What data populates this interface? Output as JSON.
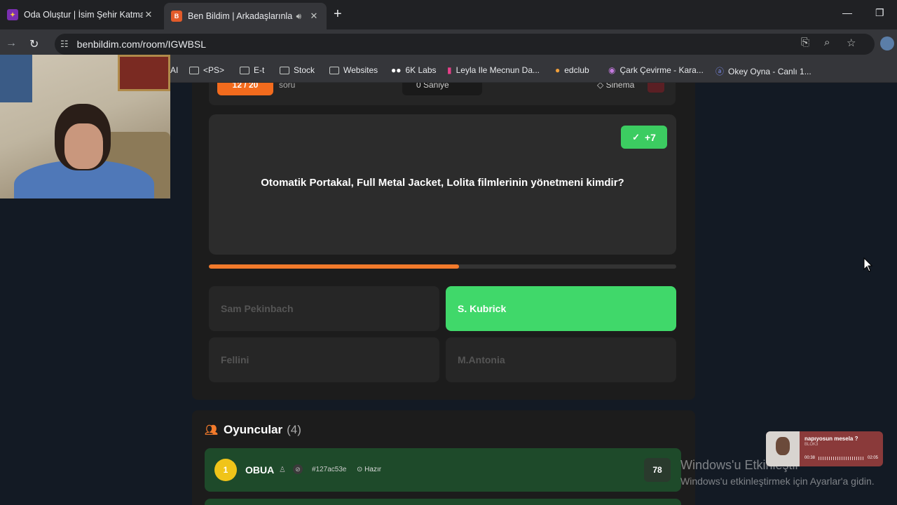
{
  "browser": {
    "tabs": [
      {
        "title": "Oda Oluştur | İsim Şehir Katman",
        "active": false
      },
      {
        "title": "Ben Bildim | Arkadaşlarınla",
        "active": true
      }
    ],
    "url": "benbildim.com/room/IGWBSL",
    "bookmarks": [
      {
        "label": "AI",
        "icon": "truncated"
      },
      {
        "label": "<PS>",
        "icon": "folder-icon"
      },
      {
        "label": "E-t",
        "icon": "folder-icon"
      },
      {
        "label": "Stock",
        "icon": "folder-icon"
      },
      {
        "label": "Websites",
        "icon": "folder-icon"
      },
      {
        "label": "6K Labs",
        "icon": "labs-icon"
      },
      {
        "label": "Leyla Ile Mecnun Da...",
        "icon": "bookmark-icon"
      },
      {
        "label": "edclub",
        "icon": "edclub-icon"
      },
      {
        "label": "Çark Çevirme - Kara...",
        "icon": "wheel-icon"
      },
      {
        "label": "Okey Oyna - Canlı 1...",
        "icon": "okey-icon"
      }
    ]
  },
  "game": {
    "progress_label": "12 / 20",
    "soru_label": "soru",
    "timer_label": "0 Saniye",
    "category_label": "Sinema",
    "score_badge": "+7",
    "question": "Otomatik Portakal, Full Metal Jacket, Lolita filmlerinin yönetmeni kimdir?",
    "time_remaining_fraction": 0.535,
    "answers": [
      {
        "label": "Sam Pekinbach",
        "correct": false
      },
      {
        "label": "S. Kubrick",
        "correct": true
      },
      {
        "label": "Fellini",
        "correct": false
      },
      {
        "label": "M.Antonia",
        "correct": false
      }
    ]
  },
  "players": {
    "title": "Oyuncular",
    "count": "(4)",
    "list": [
      {
        "rank": "1",
        "name": "OBUA",
        "id": "#127ac53e",
        "status": "Hazır",
        "score": "78"
      }
    ]
  },
  "watermark": {
    "title": "Windows'u Etkinleştir",
    "subtitle": "Windows'u etkinleştirmek için Ayarlar'a gidin."
  },
  "music": {
    "title": "napıyosun mesela ?",
    "artist": "BLOK3",
    "elapsed": "00:38",
    "total": "02:05"
  },
  "colors": {
    "accent_orange": "#f27a2b",
    "correct_green": "#40d86a",
    "player_row": "#1e4a2a"
  }
}
